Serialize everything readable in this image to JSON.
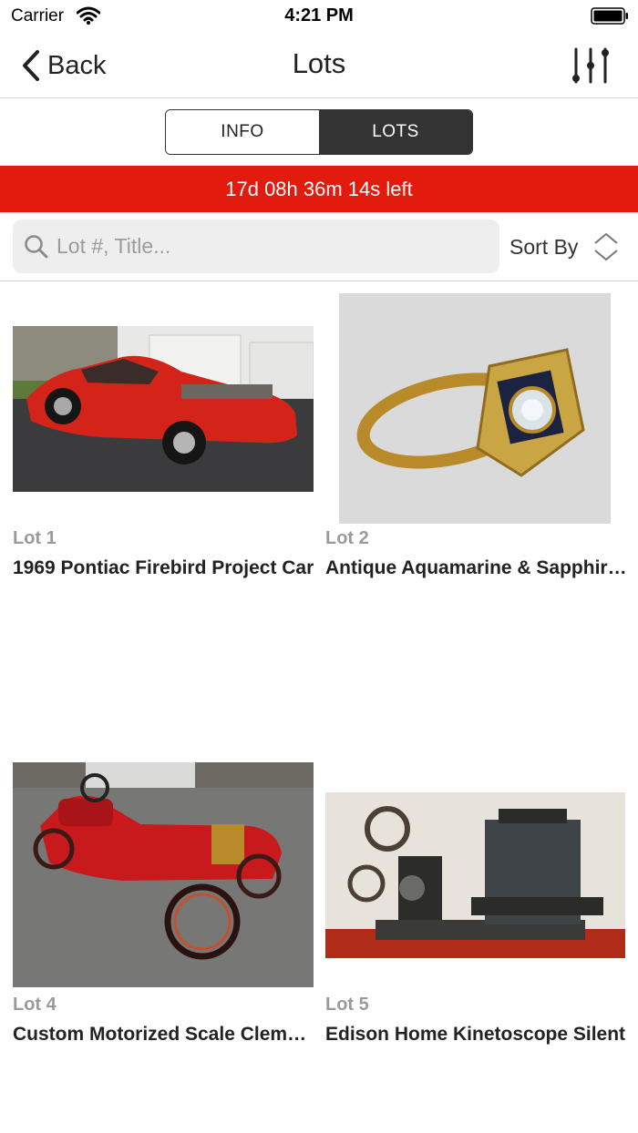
{
  "status_bar": {
    "carrier": "Carrier",
    "time": "4:21 PM"
  },
  "nav": {
    "back_label": "Back",
    "title": "Lots"
  },
  "segments": {
    "info": "INFO",
    "lots": "LOTS",
    "selected": "LOTS"
  },
  "countdown": {
    "text": "17d 08h 36m 14s left"
  },
  "search": {
    "placeholder": "Lot #, Title...",
    "value": ""
  },
  "sort": {
    "label": "Sort By"
  },
  "colors": {
    "accent_red": "#e31b0c",
    "segment_dark": "#333333"
  },
  "lots": [
    {
      "number": "Lot 1",
      "title": "1969 Pontiac Firebird Project Car"
    },
    {
      "number": "Lot 2",
      "title": "Antique Aquamarine & Sapphire Ring"
    },
    {
      "number": "Lot 4",
      "title": "Custom Motorized Scale Clement"
    },
    {
      "number": "Lot 5",
      "title": "Edison Home Kinetoscope Silent"
    }
  ]
}
